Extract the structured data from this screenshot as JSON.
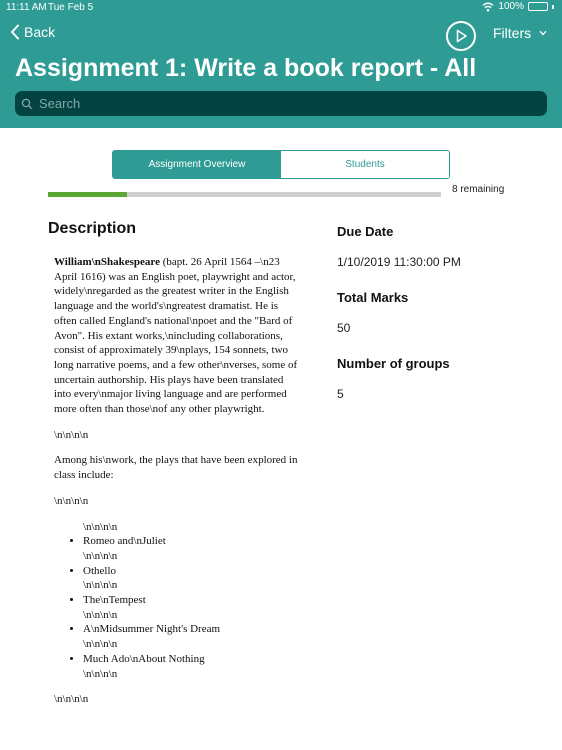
{
  "status_bar": {
    "time": "11:11 AM",
    "date": "Tue Feb 5",
    "battery": "100%"
  },
  "nav": {
    "back_label": "Back",
    "filters_label": "Filters"
  },
  "title": "Assignment 1: Write a book report - All",
  "search": {
    "placeholder": "Search"
  },
  "segments": [
    "Assignment Overview",
    "Students"
  ],
  "progress": {
    "fraction": 0.2,
    "remaining": "8 remaining"
  },
  "description": {
    "heading": "Description",
    "bold_name": "William\\nShakespeare",
    "paragraph1": " (bapt. 26 April 1564 –\\n23 April 1616) was an English poet, playwright and actor, widely\\nregarded as the greatest writer in the English language and the world's\\ngreatest dramatist. He is often called England's national\\npoet and the \"Bard of Avon\". His extant works,\\nincluding collaborations, consist of approximately 39\\nplays, 154 sonnets, two long narrative poems, and a few other\\nverses, some of uncertain authorship. His plays have been translated into every\\nmajor living language and are performed more often than those\\nof any other playwright.",
    "separator": "\\n\\n\\n\\n",
    "paragraph2": "Among his\\nwork, the plays that have been explored in class include:",
    "plays": [
      "Romeo and\\nJuliet",
      "Othello",
      "The\\nTempest",
      "A\\nMidsummer Night's Dream",
      "Much Ado\\nAbout Nothing"
    ]
  },
  "side": {
    "due_date_label": "Due Date",
    "due_date_value": "1/10/2019 11:30:00 PM",
    "total_marks_label": "Total Marks",
    "total_marks_value": "50",
    "groups_label": "Number of groups",
    "groups_value": "5"
  },
  "colors": {
    "header": "#2e9c95",
    "search_bg": "#034341",
    "progress_fill": "#5aa833",
    "battery": "#63d35a"
  }
}
